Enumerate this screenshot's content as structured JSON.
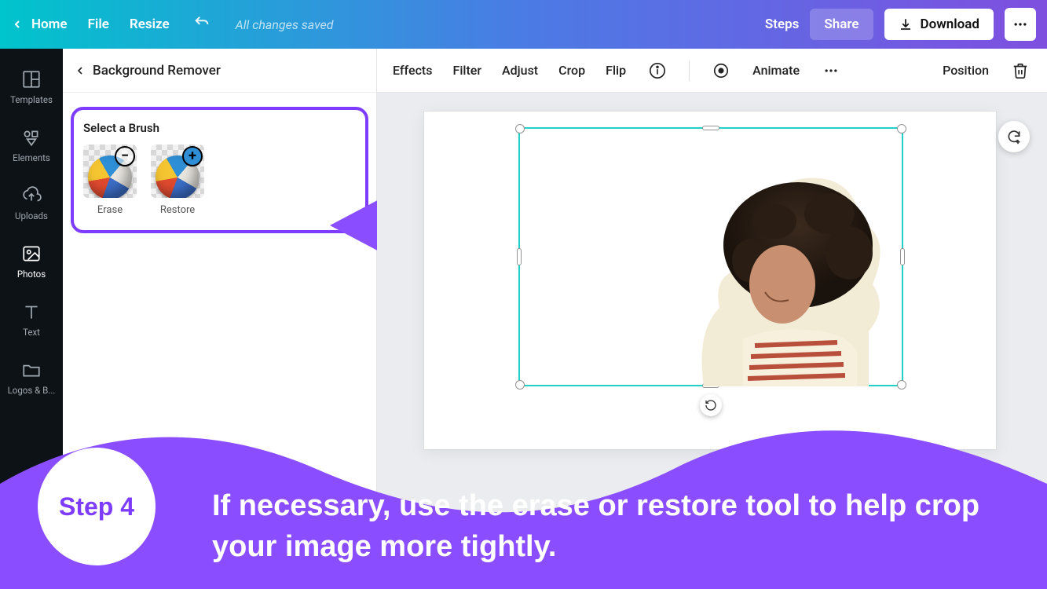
{
  "topbar": {
    "home": "Home",
    "file": "File",
    "resize": "Resize",
    "status": "All changes saved",
    "steps": "Steps",
    "share": "Share",
    "download": "Download"
  },
  "sidebar": {
    "items": [
      {
        "label": "Templates"
      },
      {
        "label": "Elements"
      },
      {
        "label": "Uploads"
      },
      {
        "label": "Photos"
      },
      {
        "label": "Text"
      },
      {
        "label": "Logos & B..."
      }
    ]
  },
  "panel": {
    "title": "Background Remover",
    "brush_title": "Select a Brush",
    "erase": "Erase",
    "restore": "Restore"
  },
  "toolbar": {
    "effects": "Effects",
    "filter": "Filter",
    "adjust": "Adjust",
    "crop": "Crop",
    "flip": "Flip",
    "animate": "Animate",
    "position": "Position"
  },
  "annotation": {
    "step_label": "Step 4",
    "instruction": "If necessary, use the erase or restore tool to help crop your image more tightly."
  }
}
